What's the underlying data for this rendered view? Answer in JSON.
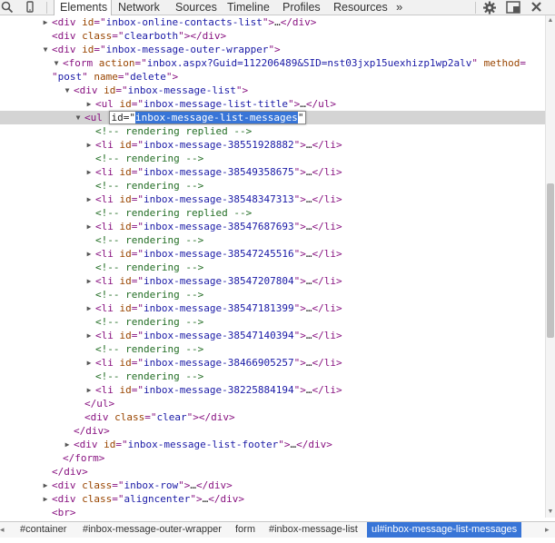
{
  "toolbar": {
    "tabs": [
      {
        "label": "Elements",
        "active": true
      },
      {
        "label": "Network",
        "active": false
      },
      {
        "label": "Sources",
        "active": false
      },
      {
        "label": "Timeline",
        "active": false
      },
      {
        "label": "Profiles",
        "active": false
      },
      {
        "label": "Resources",
        "active": false
      }
    ],
    "more": "»"
  },
  "dom": [
    {
      "tri": "right",
      "parts": [
        [
          "tag",
          "<div "
        ],
        [
          "an",
          "id"
        ],
        [
          "tag",
          "=\""
        ],
        [
          "av",
          "inbox-online-contacts-list"
        ],
        [
          "tag",
          "\">"
        ],
        [
          "dots",
          "…"
        ],
        [
          "tag",
          "</div>"
        ]
      ]
    },
    {
      "tri": "",
      "parts": [
        [
          "tag",
          "<div "
        ],
        [
          "an",
          "class"
        ],
        [
          "tag",
          "=\""
        ],
        [
          "av",
          "clearboth"
        ],
        [
          "tag",
          "\"></div>"
        ]
      ]
    },
    {
      "tri": "down",
      "parts": [
        [
          "tag",
          "<div "
        ],
        [
          "an",
          "id"
        ],
        [
          "tag",
          "=\""
        ],
        [
          "av",
          "inbox-message-outer-wrapper"
        ],
        [
          "tag",
          "\">"
        ]
      ]
    },
    {
      "tri": "down",
      "parts": [
        [
          "tag",
          "<form "
        ],
        [
          "an",
          "action"
        ],
        [
          "tag",
          "=\""
        ],
        [
          "av",
          "inbox.aspx?Guid=112206489&SID=nst03jxp15uexhizp1wp2alv"
        ],
        [
          "tag",
          "\" "
        ],
        [
          "an",
          "method"
        ],
        [
          "tag",
          "="
        ]
      ]
    },
    {
      "tri": "",
      "parts": [
        [
          "tag",
          "\""
        ],
        [
          "av",
          "post"
        ],
        [
          "tag",
          "\" "
        ],
        [
          "an",
          "name"
        ],
        [
          "tag",
          "=\""
        ],
        [
          "av",
          "delete"
        ],
        [
          "tag",
          "\">"
        ]
      ]
    },
    {
      "tri": "down",
      "parts": [
        [
          "tag",
          "<div "
        ],
        [
          "an",
          "id"
        ],
        [
          "tag",
          "=\""
        ],
        [
          "av",
          "inbox-message-list"
        ],
        [
          "tag",
          "\">"
        ]
      ]
    },
    {
      "tri": "right",
      "parts": [
        [
          "tag",
          "<ul "
        ],
        [
          "an",
          "id"
        ],
        [
          "tag",
          "=\""
        ],
        [
          "av",
          "inbox-message-list-title"
        ],
        [
          "tag",
          "\">"
        ],
        [
          "dots",
          "…"
        ],
        [
          "tag",
          "</ul>"
        ]
      ]
    },
    {
      "tri": "down",
      "selected": true,
      "edit": {
        "tag": "<ul ",
        "attr": "id=\"",
        "value": "inbox-message-list-messages",
        "close": "\""
      }
    },
    {
      "tri": "",
      "parts": [
        [
          "cm",
          "<!-- rendering replied -->"
        ]
      ]
    },
    {
      "tri": "right",
      "parts": [
        [
          "tag",
          "<li "
        ],
        [
          "an",
          "id"
        ],
        [
          "tag",
          "=\""
        ],
        [
          "av",
          "inbox-message-38551928882"
        ],
        [
          "tag",
          "\">"
        ],
        [
          "dots",
          "…"
        ],
        [
          "tag",
          "</li>"
        ]
      ]
    },
    {
      "tri": "",
      "parts": [
        [
          "cm",
          "<!-- rendering -->"
        ]
      ]
    },
    {
      "tri": "right",
      "parts": [
        [
          "tag",
          "<li "
        ],
        [
          "an",
          "id"
        ],
        [
          "tag",
          "=\""
        ],
        [
          "av",
          "inbox-message-38549358675"
        ],
        [
          "tag",
          "\">"
        ],
        [
          "dots",
          "…"
        ],
        [
          "tag",
          "</li>"
        ]
      ]
    },
    {
      "tri": "",
      "parts": [
        [
          "cm",
          "<!-- rendering -->"
        ]
      ]
    },
    {
      "tri": "right",
      "parts": [
        [
          "tag",
          "<li "
        ],
        [
          "an",
          "id"
        ],
        [
          "tag",
          "=\""
        ],
        [
          "av",
          "inbox-message-38548347313"
        ],
        [
          "tag",
          "\">"
        ],
        [
          "dots",
          "…"
        ],
        [
          "tag",
          "</li>"
        ]
      ]
    },
    {
      "tri": "",
      "parts": [
        [
          "cm",
          "<!-- rendering replied -->"
        ]
      ]
    },
    {
      "tri": "right",
      "parts": [
        [
          "tag",
          "<li "
        ],
        [
          "an",
          "id"
        ],
        [
          "tag",
          "=\""
        ],
        [
          "av",
          "inbox-message-38547687693"
        ],
        [
          "tag",
          "\">"
        ],
        [
          "dots",
          "…"
        ],
        [
          "tag",
          "</li>"
        ]
      ]
    },
    {
      "tri": "",
      "parts": [
        [
          "cm",
          "<!-- rendering -->"
        ]
      ]
    },
    {
      "tri": "right",
      "parts": [
        [
          "tag",
          "<li "
        ],
        [
          "an",
          "id"
        ],
        [
          "tag",
          "=\""
        ],
        [
          "av",
          "inbox-message-38547245516"
        ],
        [
          "tag",
          "\">"
        ],
        [
          "dots",
          "…"
        ],
        [
          "tag",
          "</li>"
        ]
      ]
    },
    {
      "tri": "",
      "parts": [
        [
          "cm",
          "<!-- rendering -->"
        ]
      ]
    },
    {
      "tri": "right",
      "parts": [
        [
          "tag",
          "<li "
        ],
        [
          "an",
          "id"
        ],
        [
          "tag",
          "=\""
        ],
        [
          "av",
          "inbox-message-38547207804"
        ],
        [
          "tag",
          "\">"
        ],
        [
          "dots",
          "…"
        ],
        [
          "tag",
          "</li>"
        ]
      ]
    },
    {
      "tri": "",
      "parts": [
        [
          "cm",
          "<!-- rendering -->"
        ]
      ]
    },
    {
      "tri": "right",
      "parts": [
        [
          "tag",
          "<li "
        ],
        [
          "an",
          "id"
        ],
        [
          "tag",
          "=\""
        ],
        [
          "av",
          "inbox-message-38547181399"
        ],
        [
          "tag",
          "\">"
        ],
        [
          "dots",
          "…"
        ],
        [
          "tag",
          "</li>"
        ]
      ]
    },
    {
      "tri": "",
      "parts": [
        [
          "cm",
          "<!-- rendering -->"
        ]
      ]
    },
    {
      "tri": "right",
      "parts": [
        [
          "tag",
          "<li "
        ],
        [
          "an",
          "id"
        ],
        [
          "tag",
          "=\""
        ],
        [
          "av",
          "inbox-message-38547140394"
        ],
        [
          "tag",
          "\">"
        ],
        [
          "dots",
          "…"
        ],
        [
          "tag",
          "</li>"
        ]
      ]
    },
    {
      "tri": "",
      "parts": [
        [
          "cm",
          "<!-- rendering -->"
        ]
      ]
    },
    {
      "tri": "right",
      "parts": [
        [
          "tag",
          "<li "
        ],
        [
          "an",
          "id"
        ],
        [
          "tag",
          "=\""
        ],
        [
          "av",
          "inbox-message-38466905257"
        ],
        [
          "tag",
          "\">"
        ],
        [
          "dots",
          "…"
        ],
        [
          "tag",
          "</li>"
        ]
      ]
    },
    {
      "tri": "",
      "parts": [
        [
          "cm",
          "<!-- rendering -->"
        ]
      ]
    },
    {
      "tri": "right",
      "parts": [
        [
          "tag",
          "<li "
        ],
        [
          "an",
          "id"
        ],
        [
          "tag",
          "=\""
        ],
        [
          "av",
          "inbox-message-38225884194"
        ],
        [
          "tag",
          "\">"
        ],
        [
          "dots",
          "…"
        ],
        [
          "tag",
          "</li>"
        ]
      ]
    },
    {
      "tri": "",
      "parts": [
        [
          "tag",
          "</ul>"
        ]
      ]
    },
    {
      "tri": "",
      "parts": [
        [
          "tag",
          "<div "
        ],
        [
          "an",
          "class"
        ],
        [
          "tag",
          "=\""
        ],
        [
          "av",
          "clear"
        ],
        [
          "tag",
          "\"></div>"
        ]
      ]
    },
    {
      "tri": "",
      "parts": [
        [
          "tag",
          "</div>"
        ]
      ]
    },
    {
      "tri": "right",
      "parts": [
        [
          "tag",
          "<div "
        ],
        [
          "an",
          "id"
        ],
        [
          "tag",
          "=\""
        ],
        [
          "av",
          "inbox-message-list-footer"
        ],
        [
          "tag",
          "\">"
        ],
        [
          "dots",
          "…"
        ],
        [
          "tag",
          "</div>"
        ]
      ]
    },
    {
      "tri": "",
      "parts": [
        [
          "tag",
          "</form>"
        ]
      ]
    },
    {
      "tri": "",
      "parts": [
        [
          "tag",
          "</div>"
        ]
      ]
    },
    {
      "tri": "right",
      "parts": [
        [
          "tag",
          "<div "
        ],
        [
          "an",
          "class"
        ],
        [
          "tag",
          "=\""
        ],
        [
          "av",
          "inbox-row"
        ],
        [
          "tag",
          "\">"
        ],
        [
          "dots",
          "…"
        ],
        [
          "tag",
          "</div>"
        ]
      ]
    },
    {
      "tri": "right",
      "parts": [
        [
          "tag",
          "<div "
        ],
        [
          "an",
          "class"
        ],
        [
          "tag",
          "=\""
        ],
        [
          "av",
          "aligncenter"
        ],
        [
          "tag",
          "\">"
        ],
        [
          "dots",
          "…"
        ],
        [
          "tag",
          "</div>"
        ]
      ]
    },
    {
      "tri": "",
      "parts": [
        [
          "tag",
          "<br>"
        ]
      ]
    }
  ],
  "breadcrumbs": [
    {
      "label": "#container",
      "active": false
    },
    {
      "label": "#inbox-message-outer-wrapper",
      "active": false
    },
    {
      "label": "form",
      "active": false
    },
    {
      "label": "#inbox-message-list",
      "active": false
    },
    {
      "label": "ul#inbox-message-list-messages",
      "active": true
    }
  ],
  "colors": {
    "tag": "#881280",
    "attr_name": "#994500",
    "attr_value": "#1a1aa6",
    "comment": "#236e25",
    "selection": "#3875d7"
  }
}
